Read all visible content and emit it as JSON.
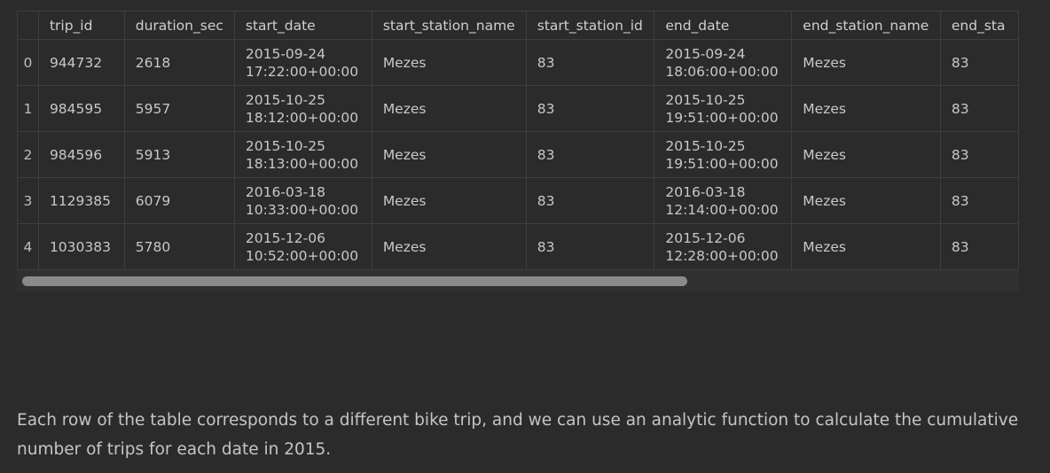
{
  "table": {
    "columns": [
      "",
      "trip_id",
      "duration_sec",
      "start_date",
      "start_station_name",
      "start_station_id",
      "end_date",
      "end_station_name",
      "end_sta"
    ],
    "rows": [
      {
        "index": "0",
        "trip_id": "944732",
        "duration_sec": "2618",
        "start_date_1": "2015-09-24",
        "start_date_2": "17:22:00+00:00",
        "start_station_name": "Mezes",
        "start_station_id": "83",
        "end_date_1": "2015-09-24",
        "end_date_2": "18:06:00+00:00",
        "end_station_name": "Mezes",
        "end_station_id": "83"
      },
      {
        "index": "1",
        "trip_id": "984595",
        "duration_sec": "5957",
        "start_date_1": "2015-10-25",
        "start_date_2": "18:12:00+00:00",
        "start_station_name": "Mezes",
        "start_station_id": "83",
        "end_date_1": "2015-10-25",
        "end_date_2": "19:51:00+00:00",
        "end_station_name": "Mezes",
        "end_station_id": "83"
      },
      {
        "index": "2",
        "trip_id": "984596",
        "duration_sec": "5913",
        "start_date_1": "2015-10-25",
        "start_date_2": "18:13:00+00:00",
        "start_station_name": "Mezes",
        "start_station_id": "83",
        "end_date_1": "2015-10-25",
        "end_date_2": "19:51:00+00:00",
        "end_station_name": "Mezes",
        "end_station_id": "83"
      },
      {
        "index": "3",
        "trip_id": "1129385",
        "duration_sec": "6079",
        "start_date_1": "2016-03-18",
        "start_date_2": "10:33:00+00:00",
        "start_station_name": "Mezes",
        "start_station_id": "83",
        "end_date_1": "2016-03-18",
        "end_date_2": "12:14:00+00:00",
        "end_station_name": "Mezes",
        "end_station_id": "83"
      },
      {
        "index": "4",
        "trip_id": "1030383",
        "duration_sec": "5780",
        "start_date_1": "2015-12-06",
        "start_date_2": "10:52:00+00:00",
        "start_station_name": "Mezes",
        "start_station_id": "83",
        "end_date_1": "2015-12-06",
        "end_date_2": "12:28:00+00:00",
        "end_station_name": "Mezes",
        "end_station_id": "83"
      }
    ]
  },
  "description": "Each row of the table corresponds to a different bike trip, and we can use an analytic function to calculate the cumulative number of trips for each date in 2015."
}
